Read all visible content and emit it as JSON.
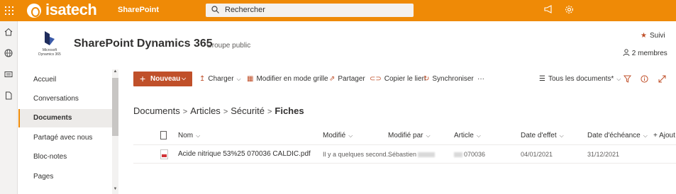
{
  "suite": {
    "brand": "isatech",
    "app_name": "SharePoint",
    "search_placeholder": "Rechercher",
    "icons": [
      "waffle-icon",
      "megaphone-icon",
      "gear-icon"
    ]
  },
  "site": {
    "logo_caption": "Microsoft Dynamics 365",
    "title": "SharePoint Dynamics 365",
    "group_label": "Groupe public",
    "follow_label": "Suivi",
    "members_label": "2 membres"
  },
  "nav": {
    "items": [
      {
        "label": "Accueil"
      },
      {
        "label": "Conversations"
      },
      {
        "label": "Documents",
        "selected": true
      },
      {
        "label": "Partagé avec nous"
      },
      {
        "label": "Bloc-notes"
      },
      {
        "label": "Pages"
      }
    ]
  },
  "commandbar": {
    "new_label": "Nouveau",
    "upload_label": "Charger",
    "grid_edit_label": "Modifier en mode grille",
    "share_label": "Partager",
    "copy_link_label": "Copier le lien",
    "sync_label": "Synchroniser",
    "more_label": "···",
    "view_label": "Tous les documents*"
  },
  "breadcrumb": {
    "items": [
      "Documents",
      "Articles",
      "Sécurité",
      "Fiches"
    ]
  },
  "table": {
    "columns": {
      "name": "Nom",
      "modified": "Modifié",
      "modified_by": "Modifié par",
      "article": "Article",
      "effective_date": "Date d'effet",
      "due_date": "Date d'échéance",
      "add_column": "+ Ajout"
    },
    "rows": [
      {
        "name": "Acide nitrique 53%25 070036 CALDIC.pdf",
        "modified": "Il y a quelques second...",
        "modified_by": "Sébastien",
        "article": "070036",
        "effective_date": "04/01/2021",
        "due_date": "31/12/2021"
      }
    ]
  },
  "colors": {
    "suite_bar": "#ef8a06",
    "accent": "#c0502a"
  }
}
